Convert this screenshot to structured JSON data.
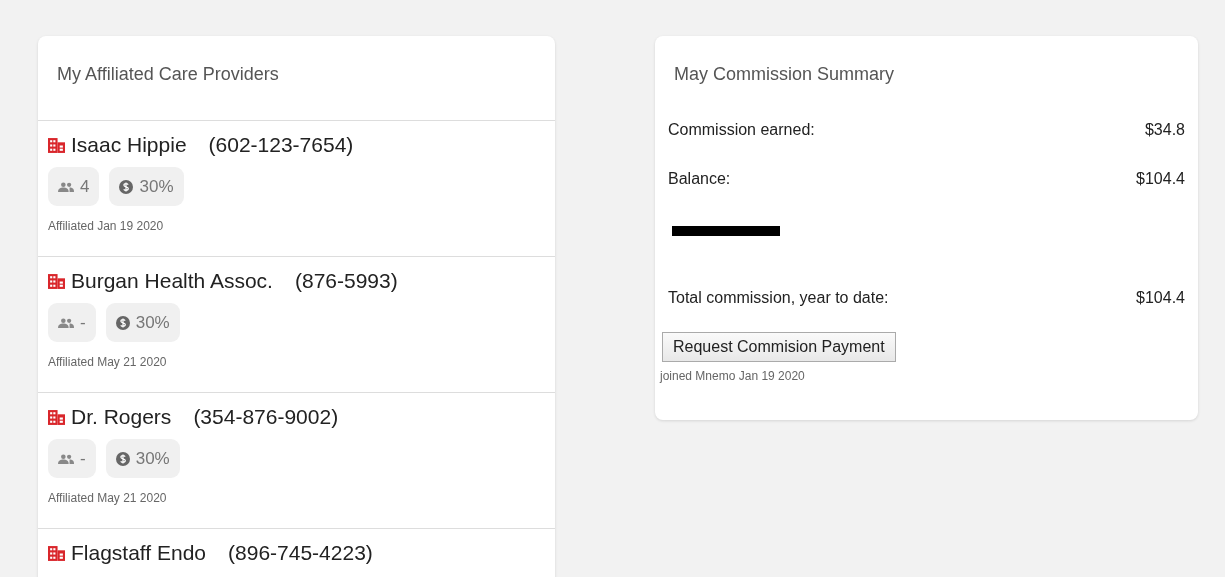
{
  "providers_card": {
    "title": "My Affiliated Care Providers",
    "providers": [
      {
        "name": "Isaac Hippie",
        "phone": "(602-123-7654)",
        "members": "4",
        "commission": "30%",
        "affiliated": "Affiliated Jan 19 2020"
      },
      {
        "name": "Burgan Health Assoc.",
        "phone": "(876-5993)",
        "members": "-",
        "commission": "30%",
        "affiliated": "Affiliated May 21 2020"
      },
      {
        "name": "Dr. Rogers",
        "phone": "(354-876-9002)",
        "members": "-",
        "commission": "30%",
        "affiliated": "Affiliated May 21 2020"
      },
      {
        "name": "Flagstaff Endo",
        "phone": "(896-745-4223)"
      }
    ]
  },
  "summary_card": {
    "title": "May Commission Summary",
    "rows": [
      {
        "kind": "value",
        "label": "Commission earned:",
        "value": "$34.8"
      },
      {
        "kind": "value",
        "label": "Balance:",
        "value": "$104.4"
      },
      {
        "kind": "redacted"
      },
      {
        "kind": "value",
        "label": "Total commission, year to date:",
        "value": "$104.4"
      }
    ],
    "button": "Request Commision Payment",
    "joined": "joined Mnemo Jan 19 2020"
  }
}
